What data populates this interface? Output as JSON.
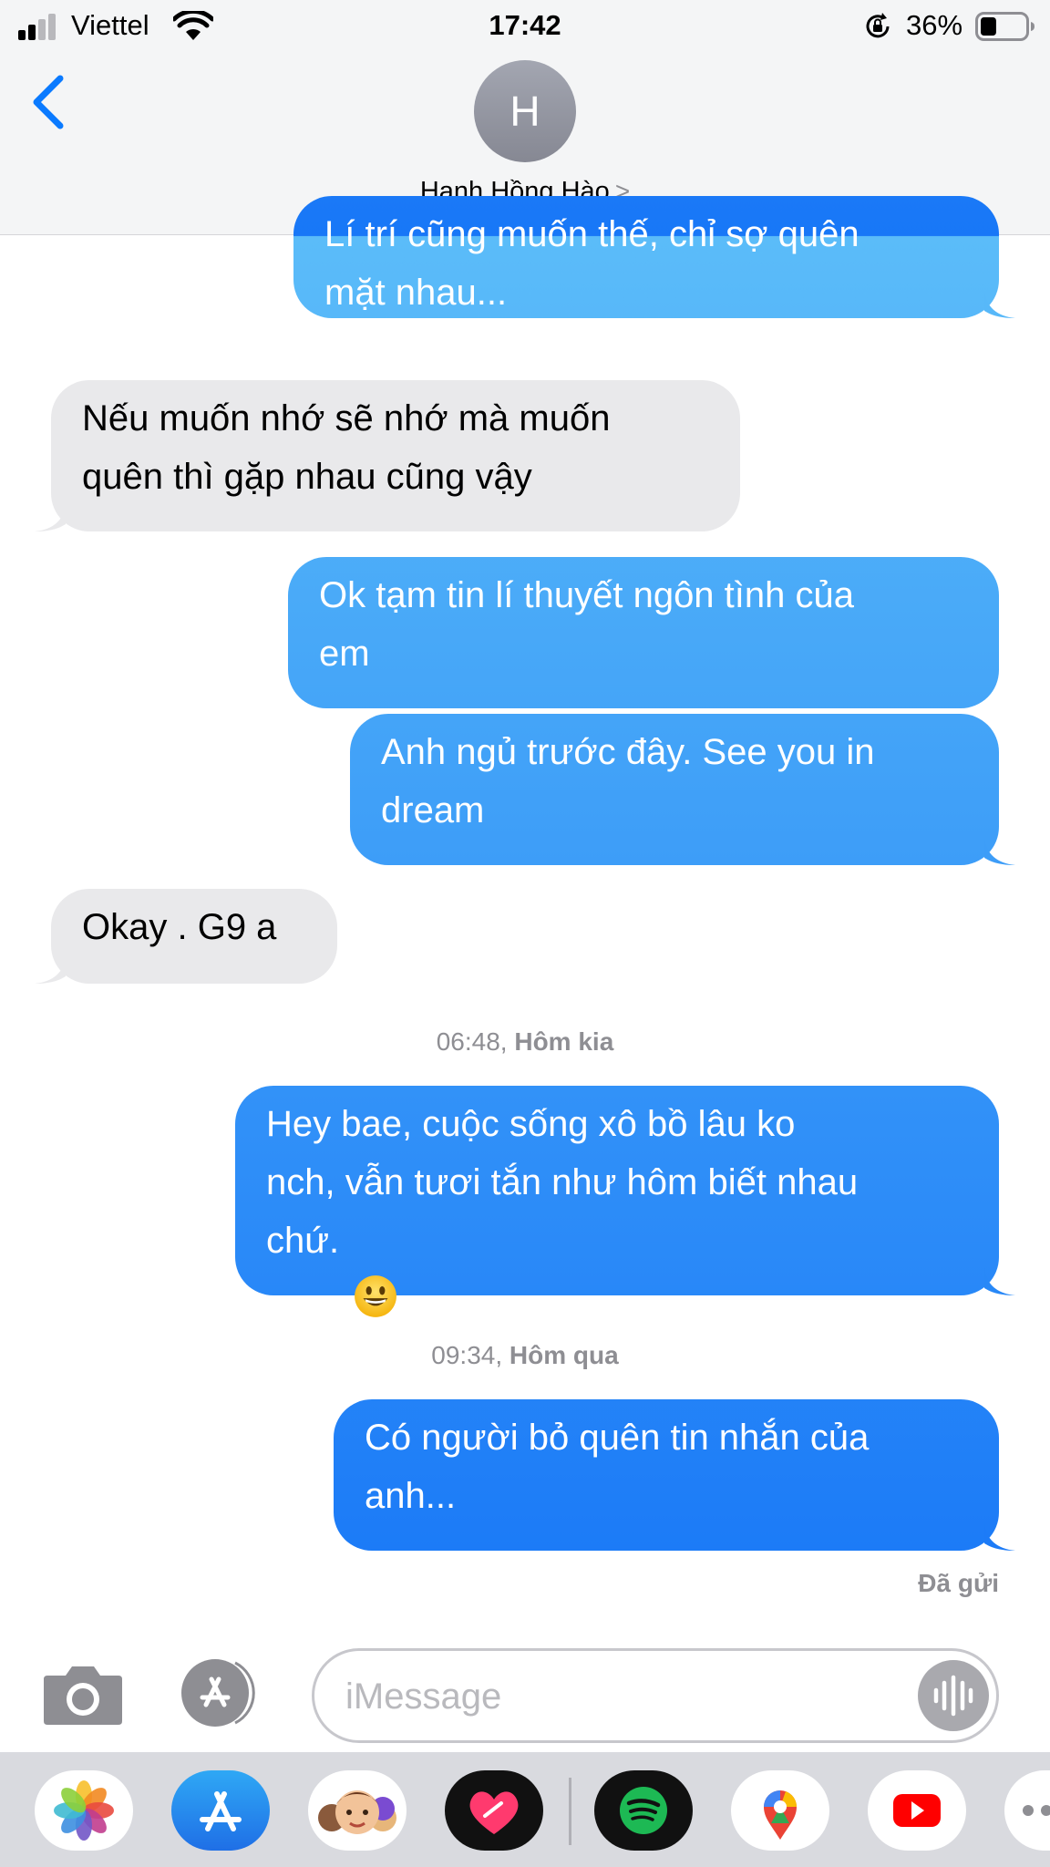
{
  "status_bar": {
    "carrier": "Viettel",
    "time": "17:42",
    "battery_percent": "36%",
    "battery_level": 0.36,
    "signal_bars": 2,
    "icons": [
      "signal-icon",
      "wifi-icon",
      "orientation-lock-icon",
      "battery-icon"
    ]
  },
  "header": {
    "back_icon": "chevron-left-icon",
    "avatar_initial": "H",
    "contact_name": "Hạnh Hồng Hào",
    "name_chevron": ">"
  },
  "conversation": {
    "messages": [
      {
        "direction": "outgoing",
        "lines": [
          "Lí trí cũng muốn thế, chỉ sợ quên",
          "mặt nhau..."
        ]
      },
      {
        "direction": "incoming",
        "lines": [
          "Nếu muốn nhớ sẽ nhớ mà muốn",
          "quên thì gặp nhau cũng vậy"
        ]
      },
      {
        "direction": "outgoing",
        "lines": [
          "Ok tạm tin lí thuyết ngôn tình của",
          "em"
        ]
      },
      {
        "direction": "outgoing",
        "lines": [
          "Anh ngủ trước đây. See you in",
          "dream"
        ]
      },
      {
        "direction": "incoming",
        "lines": [
          "Okay . G9 a"
        ]
      },
      {
        "direction": "outgoing",
        "lines": [
          "Hey bae, cuộc sống xô bồ lâu ko",
          "nch, vẫn tươi tắn như hôm biết nhau",
          "chứ."
        ],
        "emoji": "grinning-face-emoji"
      },
      {
        "direction": "outgoing",
        "lines": [
          "Có người bỏ quên tin nhắn của",
          "anh..."
        ]
      }
    ],
    "timestamps": [
      {
        "time": "06:48,",
        "day": "Hôm kia"
      },
      {
        "time": "09:34,",
        "day": "Hôm qua"
      }
    ],
    "delivery_status": "Đã gửi"
  },
  "input_bar": {
    "camera_icon": "camera-icon",
    "apps_icon": "app-store-icon",
    "placeholder": "iMessage",
    "voice_icon": "voice-waveform-icon"
  },
  "app_drawer": {
    "apps": [
      "photos-app-icon",
      "app-store-app-icon",
      "memoji-app-icon",
      "digital-touch-app-icon",
      "spotify-app-icon",
      "google-maps-app-icon",
      "youtube-app-icon",
      "more-apps-icon"
    ]
  },
  "colors": {
    "incoming_bubble": "#e9e9eb",
    "outgoing_top": "#5bbcf9",
    "outgoing_bottom": "#1877f7",
    "accent_blue": "#0a7aff",
    "timestamp_gray": "#8e8e93"
  }
}
